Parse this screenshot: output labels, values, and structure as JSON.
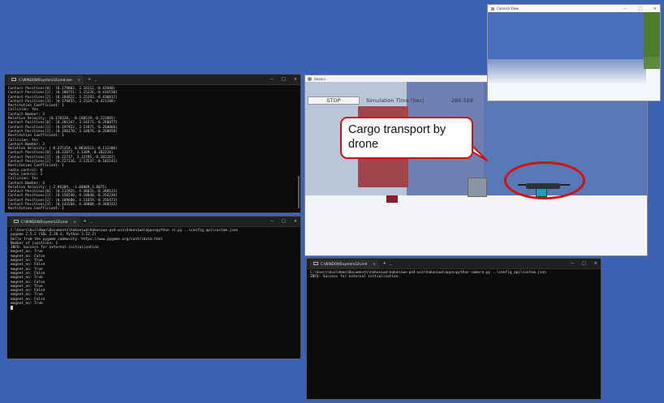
{
  "terminal_top": {
    "tab_title": "C:\\WINDOWS\\system32\\cmd.exe",
    "lines": [
      "Contact Positions[0]: (0.179803, 3.16312,-0.42948)",
      "Contact Positions[1]: (0.180751, 3.15226,-0.416150)",
      "Contact Positions[2]: (0.184822, 3.15293,-0.430817)",
      "Contact Positions[3]: (0.179455, 3.1524,-0.421186)",
      "Restitution Coefficient: 1",
      "Collision: Yes",
      "Contact Number: 3",
      "Relative Velocity: (0.178328, -0.160519,-0.222865)",
      "Contact Positions[0]: (0.201347, 3.14271,-0.260877)",
      "Contact Positions[1]: (0.197922, 3.13971,-0.260066)",
      "Contact Positions[2]: (0.196170, 3.14076,-0.260058)",
      "Restitution Coefficient: 1",
      "Collision: Yes",
      "Contact Number: 3",
      "Relative Velocity: (-0.225354, 0.0030313,-0.111306)",
      "Contact Positions[0]: (0.22077, 3.1309,-0.182214)",
      "Contact Positions[1]: (0.22717, 3.12795,-0.182162)",
      "Contact Positions[2]: (0.227116, 3.13537,-0.182141)",
      "Restitution Coefficient: 1",
      "radio_control: 0",
      "radio_control: 1",
      "Collision: Yes",
      "Contact Number: 4",
      "Relative Velocity: (-2.96389, -1.04089,3.0075)",
      "Contact Positions[0]: (0.112925, 4.30031,-0.368123)",
      "Contact Positions[1]: (0.150246, 4.10840,-0.356236)",
      "Contact Positions[2]: (0.109680, 4.11659,-0.356473)",
      "Contact Positions[3]: (0.143260, 4.30808,-0.360332)",
      "Restitution Coefficient: 1"
    ]
  },
  "terminal_left": {
    "tab_title": "C:\\WINDOWS\\system32\\cmd",
    "lines": [
      "C:\\Users\\buildman\\Documents\\hakoniwa\\hakoniwa-px4-win\\hakoniwa\\apps>python rc.py ..\\config_api\\custom.json",
      "pygame 2.5.2 (SDL 2.28.3, Python 3.12.2)",
      "Hello from the pygame community. https://www.pygame.org/contribute.html",
      "Number of joysticks: 1",
      "INFO: Success for external initialization.",
      "magnet_on: True",
      "magnet_on: False",
      "magnet_on: True",
      "magnet_on: False",
      "magnet_on: True",
      "magnet_on: False",
      "magnet_on: True",
      "magnet_on: False",
      "magnet_on: True",
      "magnet_on: False",
      "magnet_on: True",
      "magnet_on: False",
      "magnet_on: True"
    ]
  },
  "terminal_right": {
    "tab_title": "C:\\WINDOWS\\system32\\cmd",
    "lines": [
      "C:\\Users\\buildman\\Documents\\hakoniwa\\hakoniwa-px4-win\\hakoniwa\\apps>python camera.py ..\\config_api\\custom.json",
      "INFO: Success for external initialization."
    ]
  },
  "simulator": {
    "title": "Hakoni",
    "stop_label": "STOP",
    "time_label": "Simulation Time (Sec)",
    "time_value": "286.589"
  },
  "camera_view": {
    "title": "Camera View"
  },
  "callout": {
    "text": "Cargo transport by drone"
  },
  "glyphs": {
    "close": "×",
    "plus": "+",
    "chevron": "⌄",
    "minimize": "−",
    "maximize": "□"
  }
}
